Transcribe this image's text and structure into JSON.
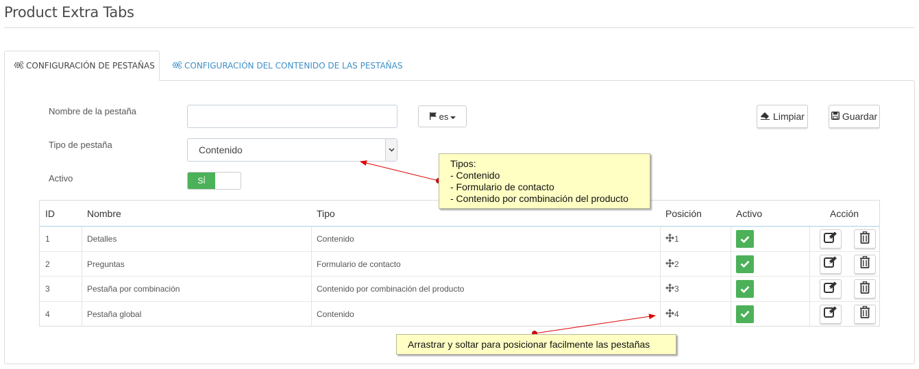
{
  "page": {
    "title": "Product Extra Tabs"
  },
  "tabs": [
    {
      "label": "CONFIGURACIÓN DE PESTAÑAS",
      "active": true
    },
    {
      "label": "CONFIGURACIÓN DEL CONTENIDO DE LAS PESTAÑAS",
      "active": false
    }
  ],
  "form": {
    "name_label": "Nombre de la pestaña",
    "name_value": "",
    "lang_button": "es",
    "type_label": "Tipo de pestaña",
    "type_value": "Contenido",
    "active_label": "Activo",
    "active_toggle": "SÍ"
  },
  "buttons": {
    "clear": "Limpiar",
    "save": "Guardar"
  },
  "table": {
    "headers": [
      "ID",
      "Nombre",
      "Tipo",
      "Posición",
      "Activo",
      "Acción"
    ],
    "rows": [
      {
        "id": "1",
        "name": "Detalles",
        "type": "Contenido",
        "position": "1"
      },
      {
        "id": "2",
        "name": "Preguntas",
        "type": "Formulario de contacto",
        "position": "2"
      },
      {
        "id": "3",
        "name": "Pestaña por combinación",
        "type": "Contenido por combinación del producto",
        "position": "3"
      },
      {
        "id": "4",
        "name": "Pestaña global",
        "type": "Contenido",
        "position": "4"
      }
    ]
  },
  "notes": {
    "types": [
      "Tipos:",
      "- Contenido",
      "- Formulario de contacto",
      "- Contenido por combinación del producto"
    ],
    "drag": "Arrastrar y soltar para posicionar facilmente las pestañas"
  },
  "colors": {
    "accent": "#3e8fc6",
    "success": "#4cb159",
    "note_bg": "#ffffc4",
    "arrow": "#e00000"
  }
}
